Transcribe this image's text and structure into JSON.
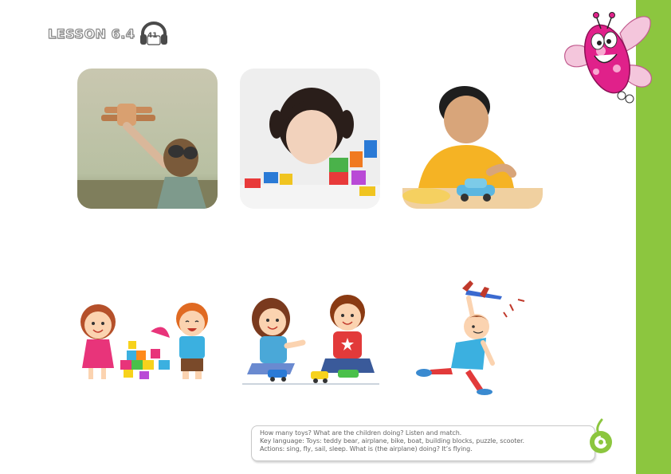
{
  "header": {
    "lesson_label": "LESSON 6.4",
    "audio_track": "41",
    "audio_icon": "headphones-icon"
  },
  "photos": [
    {
      "name": "photo-child-holding-toy-airplane",
      "subject": "child with toy airplane"
    },
    {
      "name": "photo-girl-building-blocks",
      "subject": "girl playing with building blocks"
    },
    {
      "name": "photo-boy-toy-car",
      "subject": "boy playing with toy car"
    }
  ],
  "illustrations": [
    {
      "name": "illustration-children-building-blocks"
    },
    {
      "name": "illustration-children-toy-cars"
    },
    {
      "name": "illustration-boy-flying-toy-plane"
    }
  ],
  "instructions": {
    "line1": "How many toys? What are the children doing? Listen and match.",
    "line2": "Key language: Toys: teddy bear, airplane, bike, boat, building blocks, puzzle, scooter.",
    "line3": "Actions: sing, fly, sail, sleep. What is (the airplane) doing? It’s flying."
  },
  "colors": {
    "side_bar": "#8cc63f",
    "mascot_pink": "#e0218a",
    "logo_green": "#8cc63f"
  }
}
